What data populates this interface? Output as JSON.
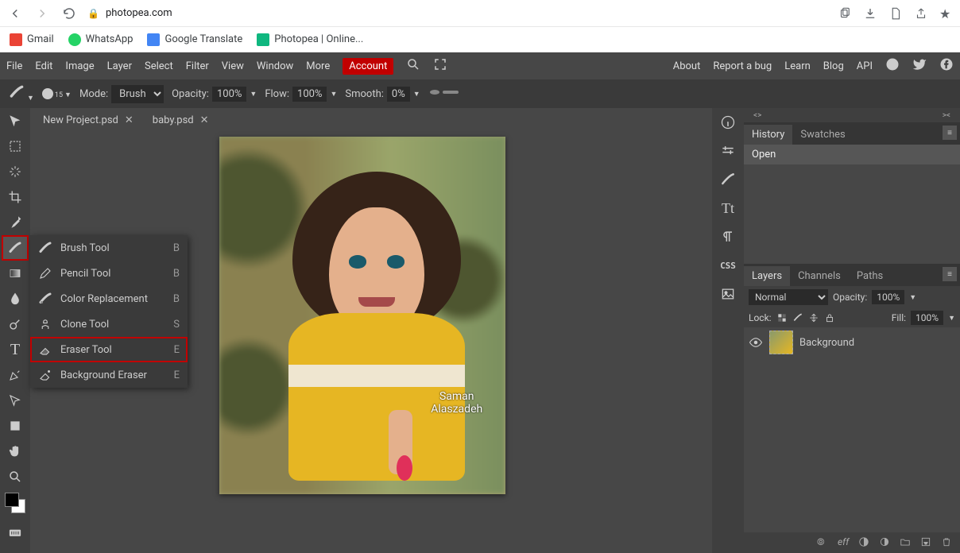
{
  "browser": {
    "url": "photopea.com",
    "bookmarks": [
      {
        "label": "Gmail"
      },
      {
        "label": "WhatsApp"
      },
      {
        "label": "Google Translate"
      },
      {
        "label": "Photopea | Online..."
      }
    ]
  },
  "app": {
    "menubar": [
      "File",
      "Edit",
      "Image",
      "Layer",
      "Select",
      "Filter",
      "View",
      "Window",
      "More"
    ],
    "account_label": "Account",
    "right_links": [
      "About",
      "Report a bug",
      "Learn",
      "Blog",
      "API"
    ],
    "options_bar": {
      "mode_label": "Mode:",
      "mode_value": "Brush",
      "opacity_label": "Opacity:",
      "opacity_value": "100%",
      "flow_label": "Flow:",
      "flow_value": "100%",
      "smooth_label": "Smooth:",
      "smooth_value": "0%",
      "brush_size": "15"
    },
    "tabs": [
      {
        "label": "New Project.psd"
      },
      {
        "label": "baby.psd"
      }
    ],
    "flyout": [
      {
        "label": "Brush Tool",
        "key": "B"
      },
      {
        "label": "Pencil Tool",
        "key": "B"
      },
      {
        "label": "Color Replacement",
        "key": "B"
      },
      {
        "label": "Clone Tool",
        "key": "S"
      },
      {
        "label": "Eraser Tool",
        "key": "E"
      },
      {
        "label": "Background Eraser",
        "key": "E"
      }
    ],
    "watermark": {
      "line1": "Saman",
      "line2": "Alaszadeh"
    },
    "history_panel": {
      "tabs": [
        "History",
        "Swatches"
      ],
      "items": [
        "Open"
      ]
    },
    "layers_panel": {
      "tabs": [
        "Layers",
        "Channels",
        "Paths"
      ],
      "blend_mode": "Normal",
      "opacity_label": "Opacity:",
      "opacity_value": "100%",
      "lock_label": "Lock:",
      "fill_label": "Fill:",
      "fill_value": "100%",
      "layers": [
        {
          "name": "Background"
        }
      ],
      "footer_fx": "eff"
    }
  }
}
